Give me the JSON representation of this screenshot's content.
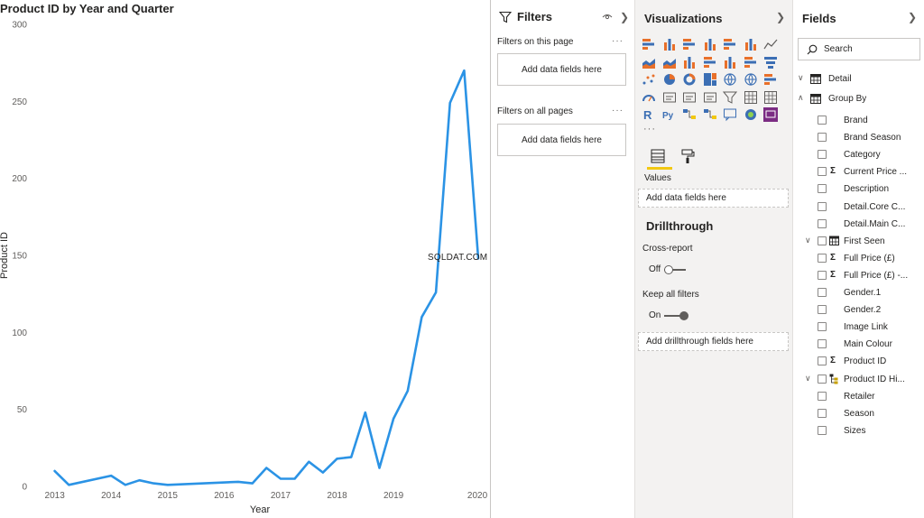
{
  "chart_data": {
    "type": "line",
    "title": "Product ID by Year and Quarter",
    "xlabel": "Year",
    "ylabel": "Product ID",
    "x_tick_labels": [
      "2013",
      "2014",
      "2015",
      "2016",
      "2017",
      "2018",
      "2019",
      "2020"
    ],
    "y_tick_labels": [
      "0",
      "50",
      "100",
      "150",
      "200",
      "250",
      "300"
    ],
    "ylim": [
      0,
      300
    ],
    "xlim": [
      2012.25,
      2020.0
    ],
    "grid": false,
    "line_color": "#2b93e5",
    "series": [
      {
        "x": [
          2012.5,
          2012.75,
          2013.5,
          2013.75,
          2014.0,
          2014.25,
          2014.5,
          2015.75,
          2016.0,
          2016.25,
          2016.5,
          2016.75,
          2017.0,
          2017.25,
          2017.5,
          2017.75,
          2018.0,
          2018.25,
          2018.5,
          2018.75,
          2019.0,
          2019.25,
          2019.5,
          2019.75,
          2020.0
        ],
        "values": [
          10,
          1,
          7,
          1,
          4,
          2,
          1,
          3,
          2,
          12,
          5,
          5,
          16,
          9,
          18,
          19,
          48,
          12,
          44,
          62,
          110,
          126,
          249,
          270,
          148
        ]
      }
    ]
  },
  "watermark": "SQLDAT.COM",
  "filters": {
    "title": "Filters",
    "on_this_page_label": "Filters on this page",
    "on_all_pages_label": "Filters on all pages",
    "dots": "···",
    "add_fields_text": "Add data fields here",
    "collapse_icon": "chevron-right-icon",
    "eye_icon": "eye-icon"
  },
  "visualizations": {
    "title": "Visualizations",
    "more": "···",
    "values_label": "Values",
    "values_drop_text": "Add data fields here",
    "drillthrough_title": "Drillthrough",
    "cross_report_label": "Cross-report",
    "cross_report_state": "Off",
    "keep_filters_label": "Keep all filters",
    "keep_filters_state": "On",
    "drillthrough_drop_text": "Add drillthrough fields here",
    "accent_color": "#f2c811"
  },
  "fields": {
    "title": "Fields",
    "search_placeholder": "Search",
    "tables": [
      {
        "name": "Detail",
        "expanded": false,
        "icon": "table-icon"
      },
      {
        "name": "Group By",
        "expanded": true,
        "icon": "table-icon"
      }
    ],
    "items": [
      {
        "label": "Brand",
        "icon": ""
      },
      {
        "label": "Brand Season",
        "icon": ""
      },
      {
        "label": "Category",
        "icon": ""
      },
      {
        "label": "Current Price ...",
        "icon": "sigma-icon"
      },
      {
        "label": "Description",
        "icon": ""
      },
      {
        "label": "Detail.Core C...",
        "icon": ""
      },
      {
        "label": "Detail.Main C...",
        "icon": ""
      },
      {
        "label": "First Seen",
        "icon": "calendar-icon",
        "expandable": true
      },
      {
        "label": "Full Price (£)",
        "icon": "sigma-icon"
      },
      {
        "label": "Full Price (£) -...",
        "icon": "sigma-icon"
      },
      {
        "label": "Gender.1",
        "icon": ""
      },
      {
        "label": "Gender.2",
        "icon": ""
      },
      {
        "label": "Image Link",
        "icon": ""
      },
      {
        "label": "Main Colour",
        "icon": ""
      },
      {
        "label": "Product ID",
        "icon": "sigma-icon"
      },
      {
        "label": "Product ID Hi...",
        "icon": "hierarchy-icon",
        "expandable": true
      },
      {
        "label": "Retailer",
        "icon": ""
      },
      {
        "label": "Season",
        "icon": ""
      },
      {
        "label": "Sizes",
        "icon": ""
      }
    ]
  }
}
